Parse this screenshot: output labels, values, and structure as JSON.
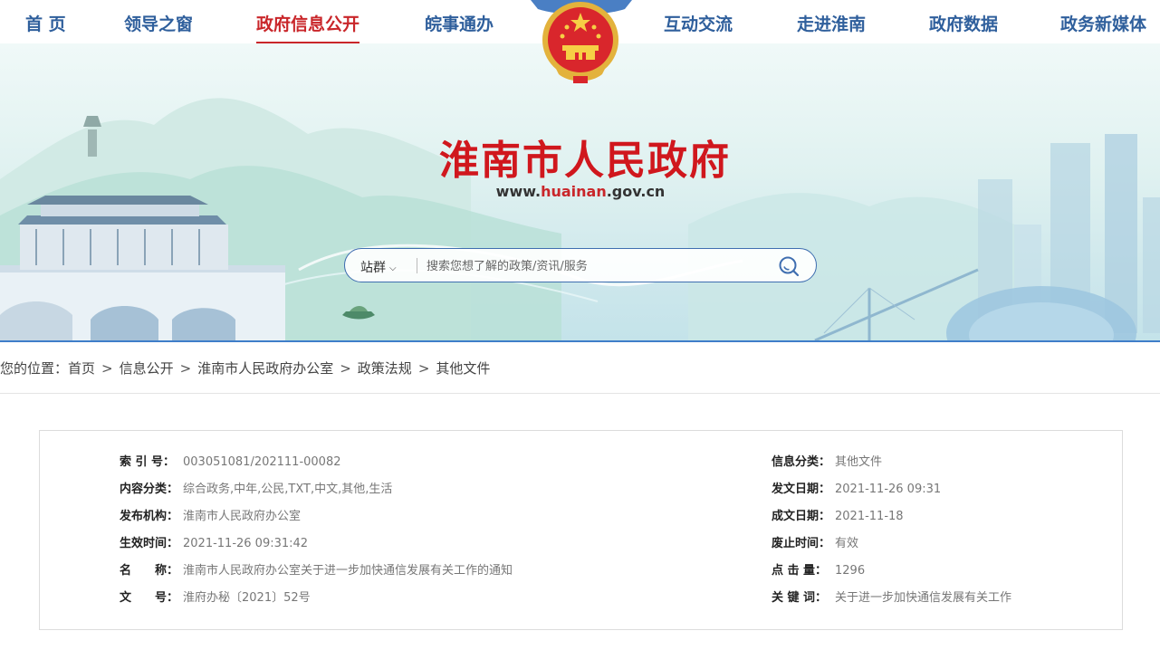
{
  "nav": {
    "items": [
      {
        "label": "首 页"
      },
      {
        "label": "领导之窗"
      },
      {
        "label": "政府信息公开",
        "active": true
      },
      {
        "label": "皖事通办"
      },
      {
        "label": "互动交流"
      },
      {
        "label": "走进淮南"
      },
      {
        "label": "政府数据"
      },
      {
        "label": "政务新媒体"
      }
    ]
  },
  "header": {
    "title": "淮南市人民政府",
    "url_prefix": "www.",
    "url_highlight": "huainan",
    "url_suffix": ".gov.cn"
  },
  "search": {
    "scope": "站群",
    "placeholder": "搜索您想了解的政策/资讯/服务"
  },
  "breadcrumb": {
    "prefix": "您的位置：",
    "items": [
      "首页",
      "信息公开",
      "淮南市人民政府办公室",
      "政策法规",
      "其他文件"
    ]
  },
  "doc_info": {
    "left": [
      {
        "label": "索 引 号：",
        "value": "003051081/202111-00082"
      },
      {
        "label": "内容分类：",
        "value": "综合政务,中年,公民,TXT,中文,其他,生活"
      },
      {
        "label": "发布机构：",
        "value": "淮南市人民政府办公室"
      },
      {
        "label": "生效时间：",
        "value": "2021-11-26 09:31:42"
      },
      {
        "label": "名　　称：",
        "value": "淮南市人民政府办公室关于进一步加快通信发展有关工作的通知"
      },
      {
        "label": "文　　号：",
        "value": "淮府办秘〔2021〕52号"
      }
    ],
    "right": [
      {
        "label": "信息分类：",
        "value": "其他文件"
      },
      {
        "label": "发文日期：",
        "value": "2021-11-26 09:31"
      },
      {
        "label": "成文日期：",
        "value": "2021-11-18"
      },
      {
        "label": "废止时间：",
        "value": "有效"
      },
      {
        "label": "点 击 量：",
        "value": "1296"
      },
      {
        "label": "关 键 词：",
        "value": "关于进一步加快通信发展有关工作"
      }
    ]
  },
  "colors": {
    "nav_text": "#2f5f9c",
    "nav_active": "#c9262a",
    "title_red": "#d0171d",
    "accent_blue": "#3f7ec9"
  },
  "icons": {
    "emblem": "national-emblem-icon",
    "search": "search-icon",
    "dropdown": "chevron-down-icon"
  }
}
